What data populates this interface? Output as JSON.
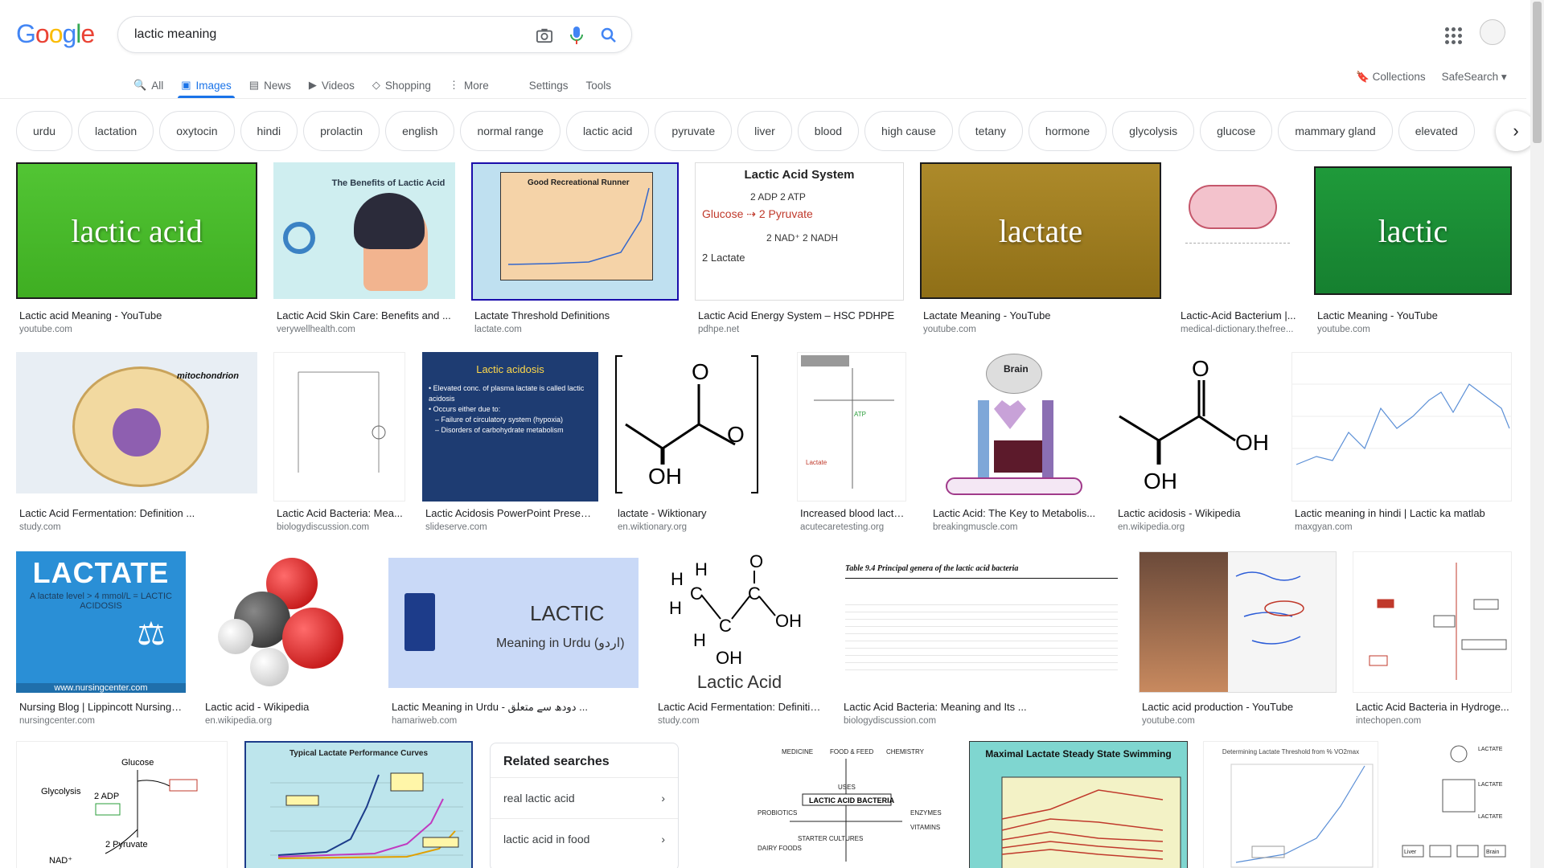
{
  "header": {
    "logo": "Google",
    "search_value": "lactic meaning",
    "camera_icon": "camera-icon",
    "mic_icon": "mic-icon",
    "search_icon": "search-icon"
  },
  "tabs": [
    {
      "label": "All",
      "icon": "🔍"
    },
    {
      "label": "Images",
      "icon": "▣"
    },
    {
      "label": "News",
      "icon": "▤"
    },
    {
      "label": "Videos",
      "icon": "▶"
    },
    {
      "label": "Shopping",
      "icon": "◇"
    },
    {
      "label": "More",
      "icon": "⋮"
    },
    {
      "label": "Settings",
      "icon": ""
    },
    {
      "label": "Tools",
      "icon": ""
    }
  ],
  "right_tools": {
    "collections": "Collections",
    "safesearch": "SafeSearch ▾"
  },
  "chips": [
    "urdu",
    "lactation",
    "oxytocin",
    "hindi",
    "prolactin",
    "english",
    "normal range",
    "lactic acid",
    "pyruvate",
    "liver",
    "blood",
    "high cause",
    "tetany",
    "hormone",
    "glycolysis",
    "glucose",
    "mammary gland",
    "elevated"
  ],
  "thumb_text": {
    "t1": "lactic acid",
    "t2": "The Benefits of Lactic Acid",
    "t3": "Good Recreational Runner",
    "t4": "Lactic Acid System",
    "t4a": "2 ADP  2 ATP",
    "t4b": "Glucose ⇢ 2 Pyruvate",
    "t4c": "2 NAD⁺  2 NADH",
    "t4d": "2 Lactate",
    "t5": "lactate",
    "t7": "lactic",
    "t9": "mitochondrion",
    "t11": "Lactic acidosis",
    "t11b": "• Elevated conc. of plasma lactate is called lactic acidosis",
    "t11c": "• Occurs either due to:",
    "t11d": "– Failure of circulatory system (hypoxia)",
    "t11e": "– Disorders of carbohydrate metabolism",
    "t14": "Brain",
    "t17": "LACTATE",
    "t17b": "A lactate level > 4 mmol/L = LACTIC ACIDOSIS",
    "t17c": "www.nursingcenter.com",
    "t19": "LACTIC",
    "t19b": "Meaning in Urdu (اردو)",
    "t20": "Lactic Acid",
    "t21": "Table 9.4  Principal genera of the lactic acid bacteria",
    "t26": "Typical Lactate Performance Curves",
    "t27": "Maximal Lactate Steady State Swimming",
    "t28": "Determining Lactate Threshold from % VO2max",
    "t24": "Glucose"
  },
  "results": {
    "r1": [
      {
        "title": "Lactic acid Meaning - YouTube",
        "source": "youtube.com"
      },
      {
        "title": "Lactic Acid Skin Care: Benefits and ...",
        "source": "verywellhealth.com"
      },
      {
        "title": "Lactate Threshold Definitions",
        "source": "lactate.com"
      },
      {
        "title": "Lactic Acid Energy System – HSC PDHPE",
        "source": "pdhpe.net"
      },
      {
        "title": "Lactate Meaning - YouTube",
        "source": "youtube.com"
      },
      {
        "title": "Lactic-Acid Bacterium |...",
        "source": "medical-dictionary.thefree..."
      },
      {
        "title": "Lactic Meaning - YouTube",
        "source": "youtube.com"
      }
    ],
    "r2": [
      {
        "title": "Lactic Acid Fermentation: Definition ...",
        "source": "study.com"
      },
      {
        "title": "Lactic Acid Bacteria: Mea...",
        "source": "biologydiscussion.com"
      },
      {
        "title": "Lactic Acidosis PowerPoint Present...",
        "source": "slideserve.com"
      },
      {
        "title": "lactate - Wiktionary",
        "source": "en.wiktionary.org"
      },
      {
        "title": "Increased blood lactat...",
        "source": "acutecaretesting.org"
      },
      {
        "title": "Lactic Acid: The Key to Metabolis...",
        "source": "breakingmuscle.com"
      },
      {
        "title": "Lactic acidosis - Wikipedia",
        "source": "en.wikipedia.org"
      },
      {
        "title": "Lactic meaning in hindi | Lactic ka matlab",
        "source": "maxgyan.com"
      }
    ],
    "r3": [
      {
        "title": "Nursing Blog | Lippincott NursingC...",
        "source": "nursingcenter.com"
      },
      {
        "title": "Lactic acid - Wikipedia",
        "source": "en.wikipedia.org"
      },
      {
        "title": "Lactic Meaning in Urdu - دودھ سے متعلق ...",
        "source": "hamariweb.com"
      },
      {
        "title": "Lactic Acid Fermentation: Definitio...",
        "source": "study.com"
      },
      {
        "title": "Lactic Acid Bacteria: Meaning and Its ...",
        "source": "biologydiscussion.com"
      },
      {
        "title": "Lactic acid production - YouTube",
        "source": "youtube.com"
      },
      {
        "title": "Lactic Acid Bacteria in Hydroge...",
        "source": "intechopen.com"
      }
    ]
  },
  "related": {
    "heading": "Related searches",
    "items": [
      "real lactic acid",
      "lactic acid in food"
    ]
  }
}
